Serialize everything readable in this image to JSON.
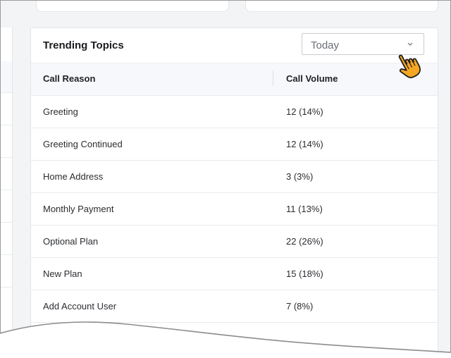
{
  "card": {
    "title": "Trending Topics",
    "period_select": {
      "value": "Today"
    }
  },
  "table": {
    "columns": [
      "Call Reason",
      "Call Volume"
    ],
    "rows": [
      {
        "reason": "Greeting",
        "volume": "12 (14%)"
      },
      {
        "reason": "Greeting Continued",
        "volume": "12 (14%)"
      },
      {
        "reason": "Home Address",
        "volume": "3 (3%)"
      },
      {
        "reason": "Monthly Payment",
        "volume": "11 (13%)"
      },
      {
        "reason": "Optional Plan",
        "volume": "22 (26%)"
      },
      {
        "reason": "New Plan",
        "volume": "15 (18%)"
      },
      {
        "reason": "Add Account User",
        "volume": "7 (8%)"
      }
    ]
  },
  "icons": {
    "dropdown": "chevron-down-icon",
    "pointer": "hand-pointer-icon"
  },
  "colors": {
    "page_background": "#f3f4f6",
    "header_row": "#f7f8fb",
    "cursor_fill": "#f5a623"
  }
}
